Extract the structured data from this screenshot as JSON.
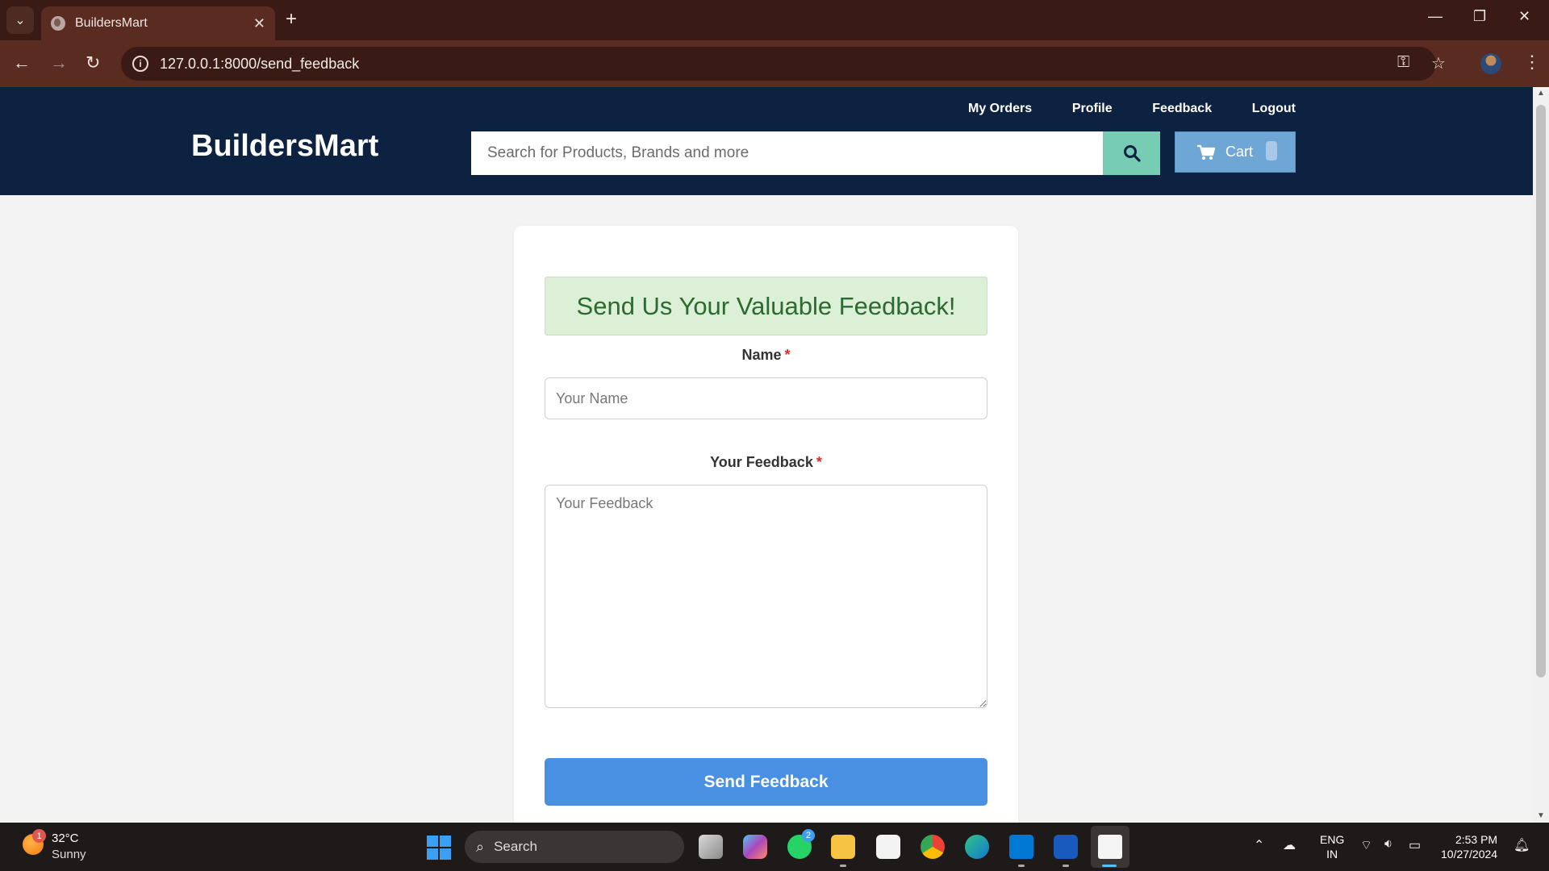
{
  "browser": {
    "tab_title": "BuildersMart",
    "url": "127.0.0.1:8000/send_feedback"
  },
  "header": {
    "brand": "BuildersMart",
    "nav": [
      "My Orders",
      "Profile",
      "Feedback",
      "Logout"
    ],
    "search_placeholder": "Search for Products, Brands and more",
    "cart_label": "Cart"
  },
  "form": {
    "banner": "Send Us Your Valuable Feedback!",
    "name_label": "Name",
    "name_placeholder": "Your Name",
    "feedback_label": "Your Feedback",
    "feedback_placeholder": "Your Feedback",
    "required_mark": "*",
    "submit_label": "Send Feedback"
  },
  "taskbar": {
    "weather_temp": "32°C",
    "weather_condition": "Sunny",
    "weather_badge": "1",
    "search_label": "Search",
    "whatsapp_badge": "2",
    "language_line1": "ENG",
    "language_line2": "IN",
    "time": "2:53 PM",
    "date": "10/27/2024"
  },
  "colors": {
    "header_bg": "#0d2240",
    "search_button": "#76cdb4",
    "cart_button": "#6ea7d6",
    "banner_bg": "#dcefd7",
    "banner_text": "#2d6a2f",
    "submit_button": "#4a90e2",
    "required": "#d9302c"
  }
}
